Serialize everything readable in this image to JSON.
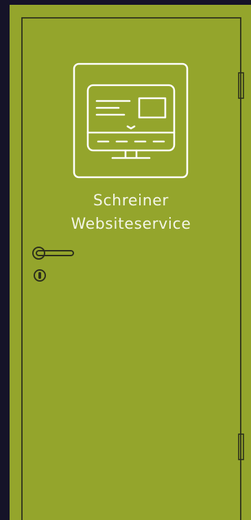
{
  "colors": {
    "background": "#151328",
    "door": "#94a52c",
    "outline": "#2b2e1c",
    "icon": "#ffffff",
    "text": "#f3f5e6"
  },
  "sign": {
    "icon": "monitor-website-icon",
    "title_line1": "Schreiner",
    "title_line2": "Websiteservice"
  },
  "door": {
    "handle_icon": "door-handle-icon",
    "keyhole_icon": "keyhole-icon",
    "hinge_icon": "hinge-icon"
  }
}
